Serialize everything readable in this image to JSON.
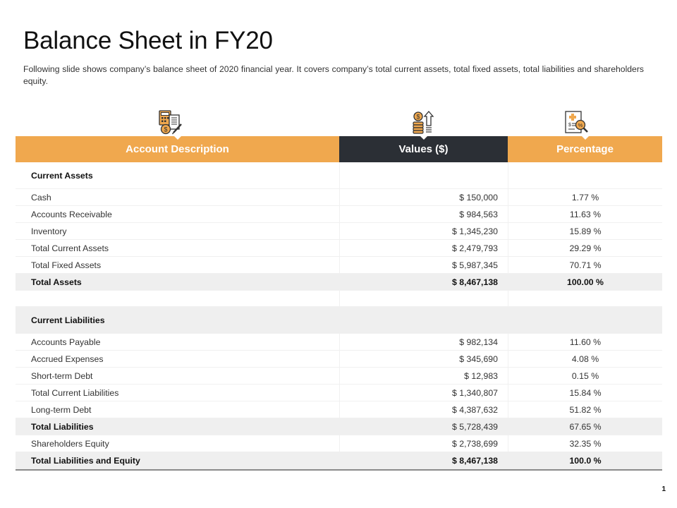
{
  "page": {
    "title": "Balance Sheet in FY20",
    "subtitle": "Following slide shows company’s balance sheet of 2020 financial year. It covers company’s total current assets, total fixed assets, total liabilities and shareholders equity.",
    "page_number": "1"
  },
  "icons": {
    "account_desc": "calculator-coins-document-icon",
    "values": "dollar-coins-arrow-icon",
    "percentage": "invoice-percent-magnifier-icon"
  },
  "colors": {
    "accent": "#f0a84e",
    "dark": "#2b2f35",
    "shade": "#efefef"
  },
  "table": {
    "headers": [
      "Account Description",
      "Values ($)",
      "Percentage"
    ],
    "rows": [
      {
        "desc": "Current Assets",
        "value": "",
        "pct": ""
      },
      {
        "desc": "Cash",
        "value": "$ 150,000",
        "pct": "1.77 %"
      },
      {
        "desc": "Accounts Receivable",
        "value": "$ 984,563",
        "pct": "11.63 %"
      },
      {
        "desc": "Inventory",
        "value": "$ 1,345,230",
        "pct": "15.89  %"
      },
      {
        "desc": "Total Current  Assets",
        "value": "$ 2,479,793",
        "pct": "29.29 %"
      },
      {
        "desc": "Total Fixed Assets",
        "value": "$ 5,987,345",
        "pct": "70.71 %"
      },
      {
        "desc": "Total Assets",
        "value": "$ 8,467,138",
        "pct": "100.00 %"
      },
      {
        "desc": "",
        "value": "",
        "pct": ""
      },
      {
        "desc": "Current Liabilities",
        "value": "",
        "pct": ""
      },
      {
        "desc": "Accounts Payable",
        "value": "$ 982,134",
        "pct": "11.60 %"
      },
      {
        "desc": "Accrued Expenses",
        "value": "$ 345,690",
        "pct": "4.08 %"
      },
      {
        "desc": "Short-term Debt",
        "value": "$ 12,983",
        "pct": "0.15 %"
      },
      {
        "desc": "Total Current  Liabilities",
        "value": "$ 1,340,807",
        "pct": "15.84 %"
      },
      {
        "desc": "Long-term Debt",
        "value": "$ 4,387,632",
        "pct": "51.82 %"
      },
      {
        "desc": "Total Liabilities",
        "value": "$ 5,728,439",
        "pct": "67.65 %"
      },
      {
        "desc": "Shareholders Equity",
        "value": "$ 2,738,699",
        "pct": "32.35 %"
      },
      {
        "desc": "Total Liabilities and Equity",
        "value": "$ 8,467,138",
        "pct": "100.0 %"
      }
    ]
  }
}
